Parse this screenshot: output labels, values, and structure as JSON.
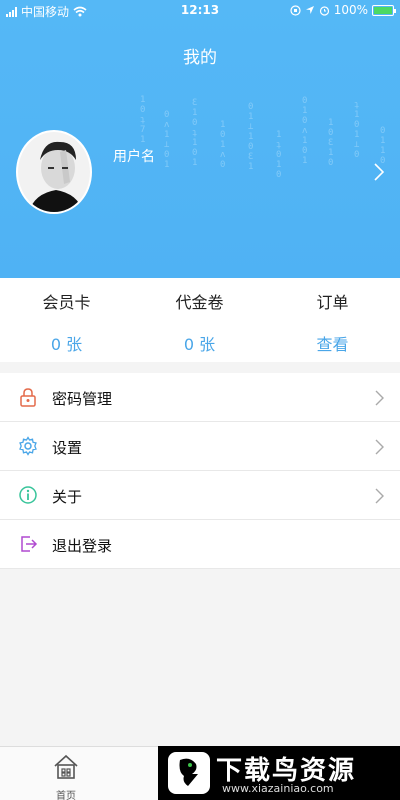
{
  "status_bar": {
    "carrier": "中国移动",
    "time": "12:13",
    "battery": "100%"
  },
  "header": {
    "title": "我的",
    "username": "用户名"
  },
  "stats": [
    {
      "label": "会员卡",
      "value": "0 张"
    },
    {
      "label": "代金卷",
      "value": "0 张"
    },
    {
      "label": "订单",
      "value": "查看"
    }
  ],
  "menu": [
    {
      "label": "密码管理",
      "icon": "lock-icon"
    },
    {
      "label": "设置",
      "icon": "gear-icon"
    },
    {
      "label": "关于",
      "icon": "info-icon"
    },
    {
      "label": "退出登录",
      "icon": "logout-icon"
    }
  ],
  "tabbar": {
    "home_label": "首页"
  },
  "watermark": {
    "title": "下载鸟资源",
    "url": "www.xiazainiao.com"
  },
  "colors": {
    "header_bg": "#55b8f6",
    "accent": "#4aa6e8"
  }
}
